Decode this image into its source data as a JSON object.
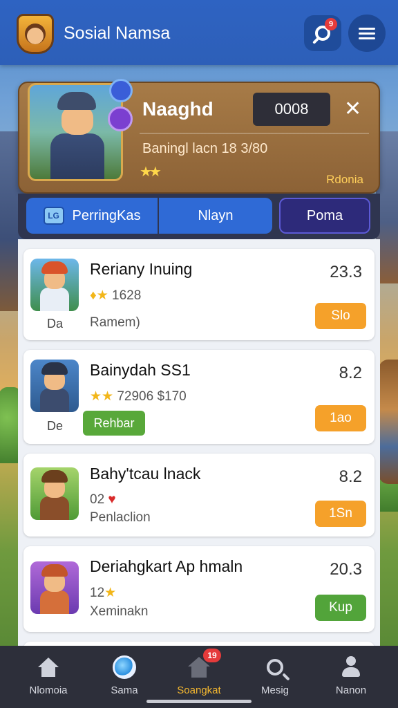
{
  "header": {
    "title": "Sosial Namsa",
    "notification_count": "9",
    "search_icon": "search-icon",
    "menu_icon": "hamburger-menu-icon"
  },
  "profile": {
    "name": "Naaghd",
    "code": "0008",
    "rank_line": "Baningl lacn 18  3/80",
    "stars": "★★",
    "region": "Rdonia"
  },
  "tabs": [
    {
      "label": "PerringKas",
      "icon_text": "LG"
    },
    {
      "label": "Nlayn"
    },
    {
      "label": "Poma"
    }
  ],
  "list": [
    {
      "title": "Reriany Inuing",
      "sub_icons": "♦★",
      "sub_text": "1628",
      "desc": "Ramem)",
      "short": "Da",
      "score": "23.3",
      "action": "Slo",
      "action_color": "#f5a12a"
    },
    {
      "title": "Bainydah SS1",
      "sub_icons": "★★",
      "sub_text": "72906 $170",
      "tag": "Rehbar",
      "short": "De",
      "score": "8.2",
      "action": "1ao",
      "action_color": "#f5a12a"
    },
    {
      "title": "Bahy'tcau lnack",
      "sub_text": "02",
      "sub_icon_red": "♥",
      "desc": "Penlaclion",
      "score": "8.2",
      "action": "1Sn",
      "action_color": "#f5a12a"
    },
    {
      "title": "Deriahgkart Ap hmaln",
      "sub_text": "12",
      "sub_icons": "★",
      "desc": "Xeminakn",
      "score": "20.3",
      "action": "Kup",
      "action_color": "#52a43a"
    }
  ],
  "bottom_nav": [
    {
      "label": "Nlomoia",
      "icon": "home-icon"
    },
    {
      "label": "Sama",
      "icon": "orb-icon"
    },
    {
      "label": "Soangkat",
      "icon": "house-icon",
      "badge": "19",
      "active": true
    },
    {
      "label": "Mesig",
      "icon": "search-icon"
    },
    {
      "label": "Nanon",
      "icon": "profile-icon"
    }
  ]
}
